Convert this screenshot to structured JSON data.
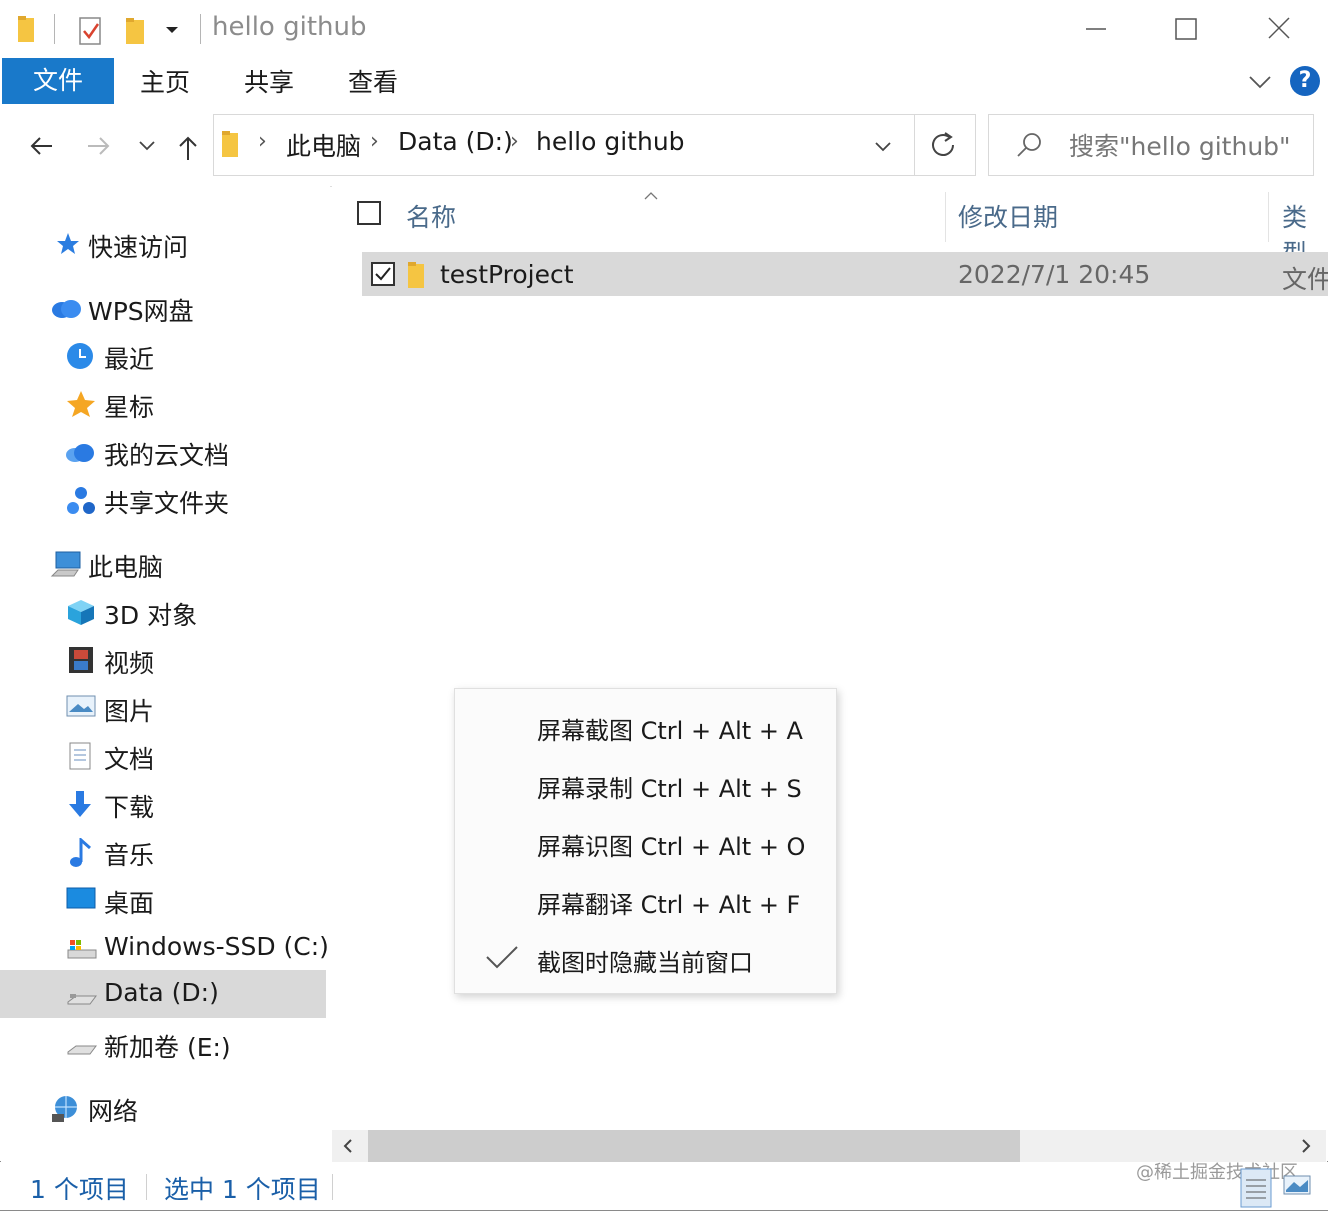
{
  "window": {
    "title": "hello github",
    "quick_access_toolbar": [
      "folder-icon",
      "properties-check-icon",
      "new-folder-icon",
      "customize-dropdown-icon"
    ]
  },
  "ribbon": {
    "file_tab": "文件",
    "tabs": [
      "主页",
      "共享",
      "查看"
    ],
    "help": "?"
  },
  "navigation": {
    "breadcrumb": [
      "此电脑",
      "Data (D:)",
      "hello github"
    ],
    "search_placeholder": "搜索\"hello github\""
  },
  "sidebar": {
    "quick_access": "快速访问",
    "wps": {
      "label": "WPS网盘",
      "items": [
        "最近",
        "星标",
        "我的云文档",
        "共享文件夹"
      ]
    },
    "this_pc": {
      "label": "此电脑",
      "items": [
        "3D 对象",
        "视频",
        "图片",
        "文档",
        "下载",
        "音乐",
        "桌面",
        "Windows-SSD (C:)",
        "Data (D:)",
        "新加卷 (E:)"
      ],
      "selected": "Data (D:)"
    },
    "network": "网络"
  },
  "file_list": {
    "columns": [
      "名称",
      "修改日期",
      "类型"
    ],
    "rows": [
      {
        "name": "testProject",
        "modified": "2022/7/1 20:45",
        "type": "文件",
        "checked": true
      }
    ]
  },
  "status_bar": {
    "item_count": "1 个项目",
    "selected_count": "选中 1 个项目"
  },
  "context_menu": {
    "items": [
      {
        "label": "屏幕截图 Ctrl + Alt + A",
        "checked": false
      },
      {
        "label": "屏幕录制 Ctrl + Alt + S",
        "checked": false
      },
      {
        "label": "屏幕识图 Ctrl + Alt + O",
        "checked": false
      },
      {
        "label": "屏幕翻译 Ctrl + Alt + F",
        "checked": false
      },
      {
        "label": "截图时隐藏当前窗口",
        "checked": true
      }
    ]
  },
  "watermark": "@稀土掘金技术社区",
  "colors": {
    "accent": "#1979ca",
    "selection": "#d9d9d9",
    "status_text": "#1a5fa8",
    "header_text": "#4a6a8a"
  }
}
